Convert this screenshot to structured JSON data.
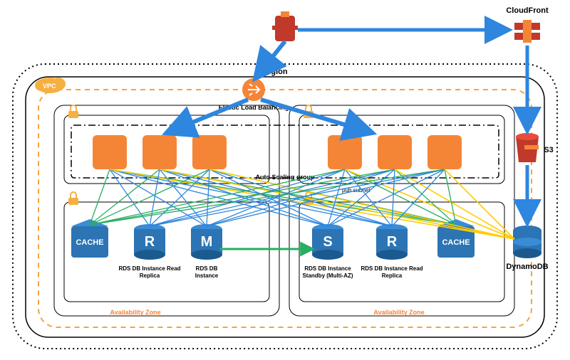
{
  "labels": {
    "cloudfront": "CloudFront",
    "s3": "S3",
    "dynamodb": "DynamoDB",
    "region": "region",
    "vpc": "VPC",
    "elb": "Elastic Load Balancing",
    "asg": "Auto Scaling group",
    "pubsubnet": "pub subnet",
    "az": "Availability Zone",
    "cache": "CACHE",
    "rds_read": "RDS DB Instance Read Replica",
    "rds_master": "RDS DB Instance",
    "rds_standby": "RDS DB Instance Standby (Multi-AZ)",
    "R": "R",
    "M": "M",
    "S": "S"
  },
  "colors": {
    "orange": "#f58536",
    "orange_dash": "#f7a23c",
    "red": "#c0392b",
    "blue": "#2e86de",
    "green": "#27ae60",
    "yellow": "#ffcc00",
    "steel": "#2c74b3",
    "badge": "#f6b042"
  }
}
